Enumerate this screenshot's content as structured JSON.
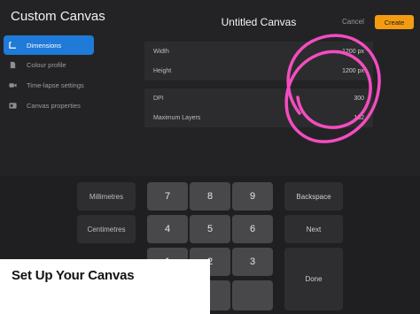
{
  "sidebar": {
    "title": "Custom Canvas",
    "items": [
      {
        "label": "Dimensions",
        "icon": "dimensions-icon",
        "active": true
      },
      {
        "label": "Colour profile",
        "icon": "colour-profile-icon",
        "active": false
      },
      {
        "label": "Time-lapse settings",
        "icon": "camera-icon",
        "active": false
      },
      {
        "label": "Canvas properties",
        "icon": "canvas-properties-icon",
        "active": false
      }
    ]
  },
  "header": {
    "title": "Untitled Canvas",
    "cancel_label": "Cancel",
    "create_label": "Create"
  },
  "fields": [
    {
      "label": "Width",
      "value": "1200 px"
    },
    {
      "label": "Height",
      "value": "1200 px"
    },
    {
      "label": "DPI",
      "value": "300"
    },
    {
      "label": "Maximum Layers",
      "value": "182"
    }
  ],
  "keypad": {
    "units": [
      "Millimetres",
      "Centimetres"
    ],
    "digits": [
      "7",
      "8",
      "9",
      "4",
      "5",
      "6",
      "1",
      "2",
      "3"
    ],
    "backspace_label": "Backspace",
    "next_label": "Next",
    "done_label": "Done"
  },
  "overlay": {
    "title": "Set Up Your Canvas"
  },
  "colors": {
    "accent_blue": "#1f7ad8",
    "create_orange": "#f39c12",
    "annotation_pink": "#ff4fc8"
  }
}
